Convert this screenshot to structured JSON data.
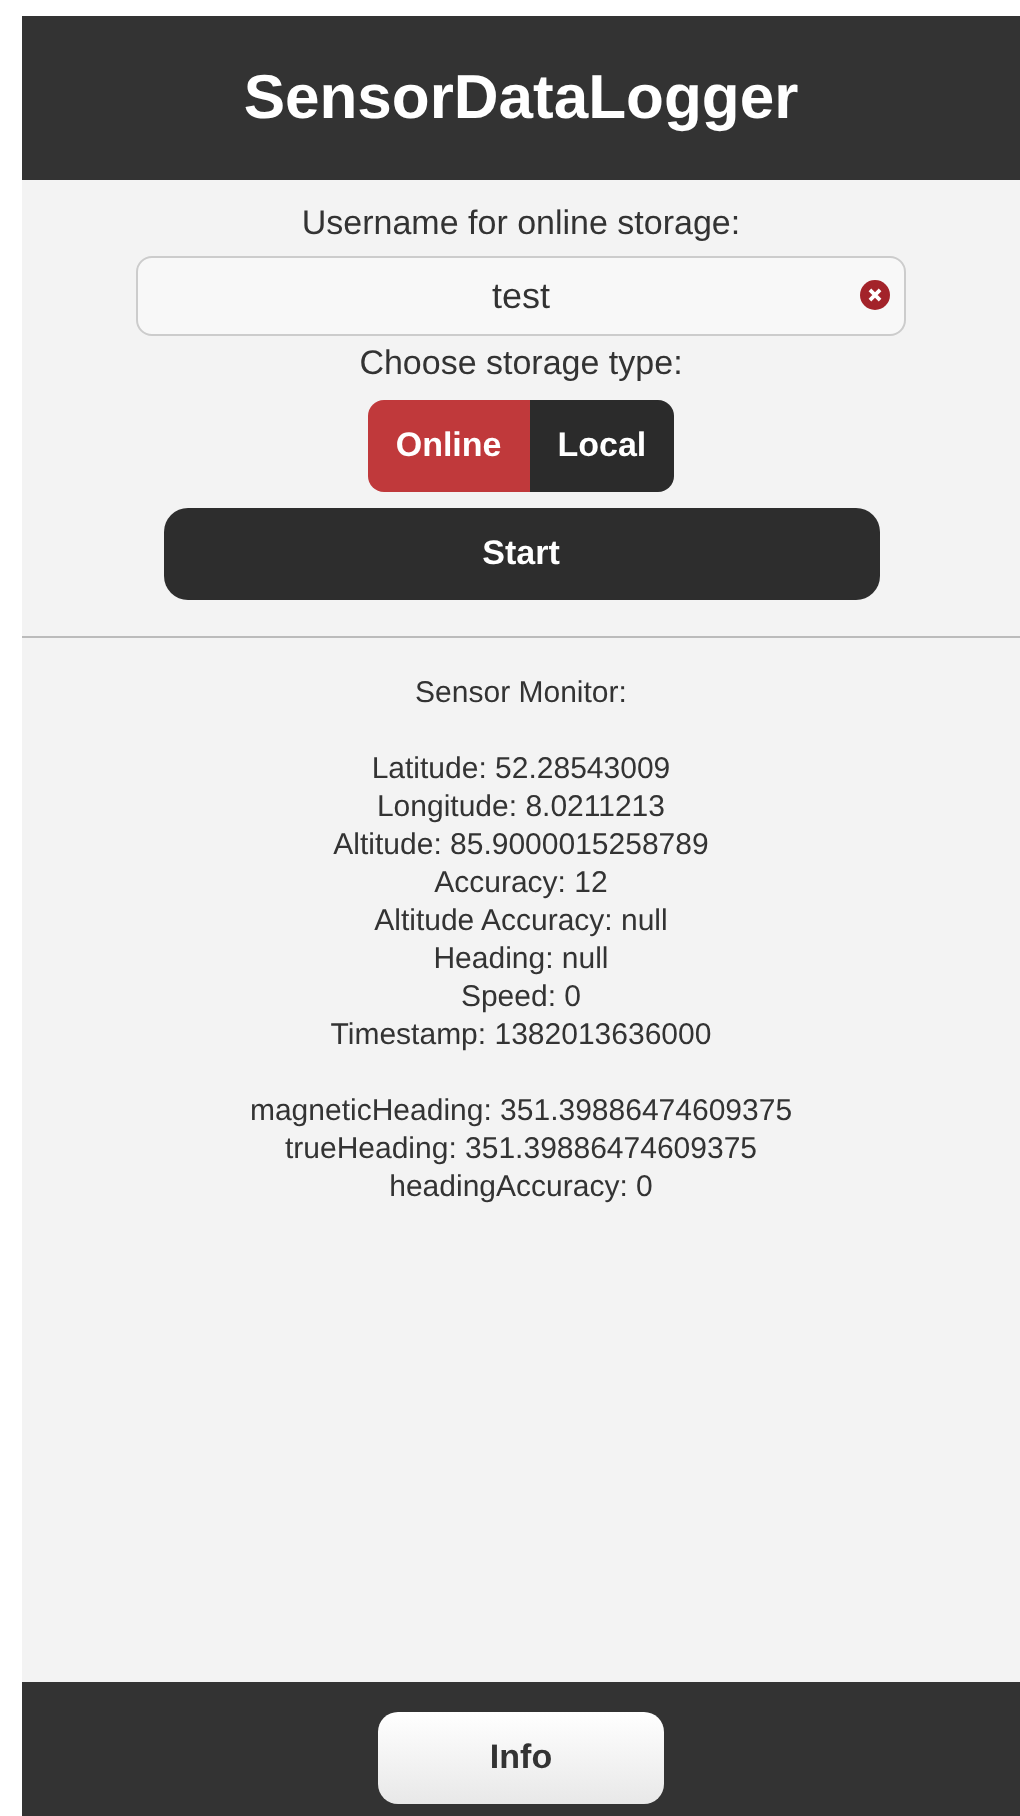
{
  "header": {
    "title": "SensorDataLogger"
  },
  "username": {
    "label": "Username for online storage:",
    "value": "test"
  },
  "storage": {
    "label": "Choose storage type:",
    "options": [
      {
        "label": "Online",
        "selected": true
      },
      {
        "label": "Local",
        "selected": false
      }
    ]
  },
  "start_button": "Start",
  "monitor": {
    "title": "Sensor Monitor:",
    "groups": [
      [
        "Latitude: 52.28543009",
        "Longitude: 8.0211213",
        "Altitude: 85.9000015258789",
        "Accuracy: 12",
        "Altitude Accuracy: null",
        "Heading: null",
        "Speed: 0",
        "Timestamp: 1382013636000"
      ],
      [
        "magneticHeading: 351.39886474609375",
        "trueHeading: 351.39886474609375",
        "headingAccuracy: 0"
      ]
    ]
  },
  "footer": {
    "button": "Info"
  }
}
